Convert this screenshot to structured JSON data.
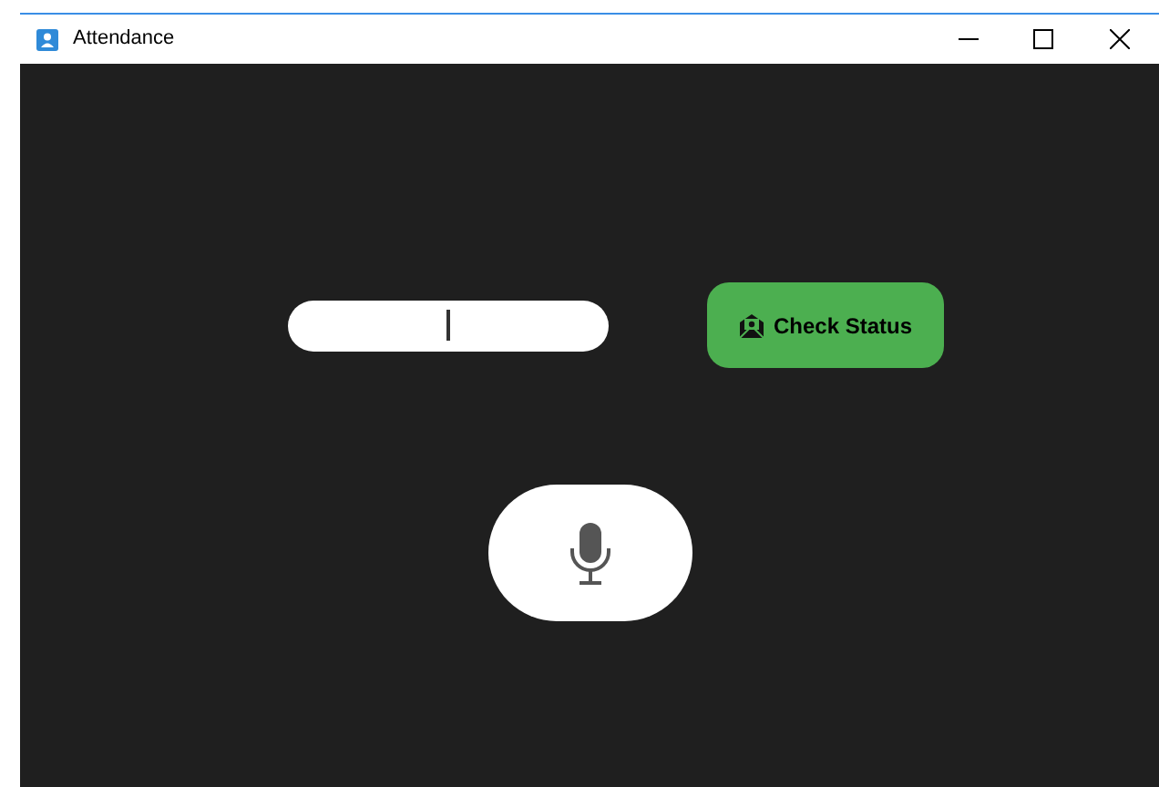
{
  "window": {
    "title": "Attendance"
  },
  "input": {
    "focused": true
  },
  "check_button": {
    "label": "Check Status"
  }
}
